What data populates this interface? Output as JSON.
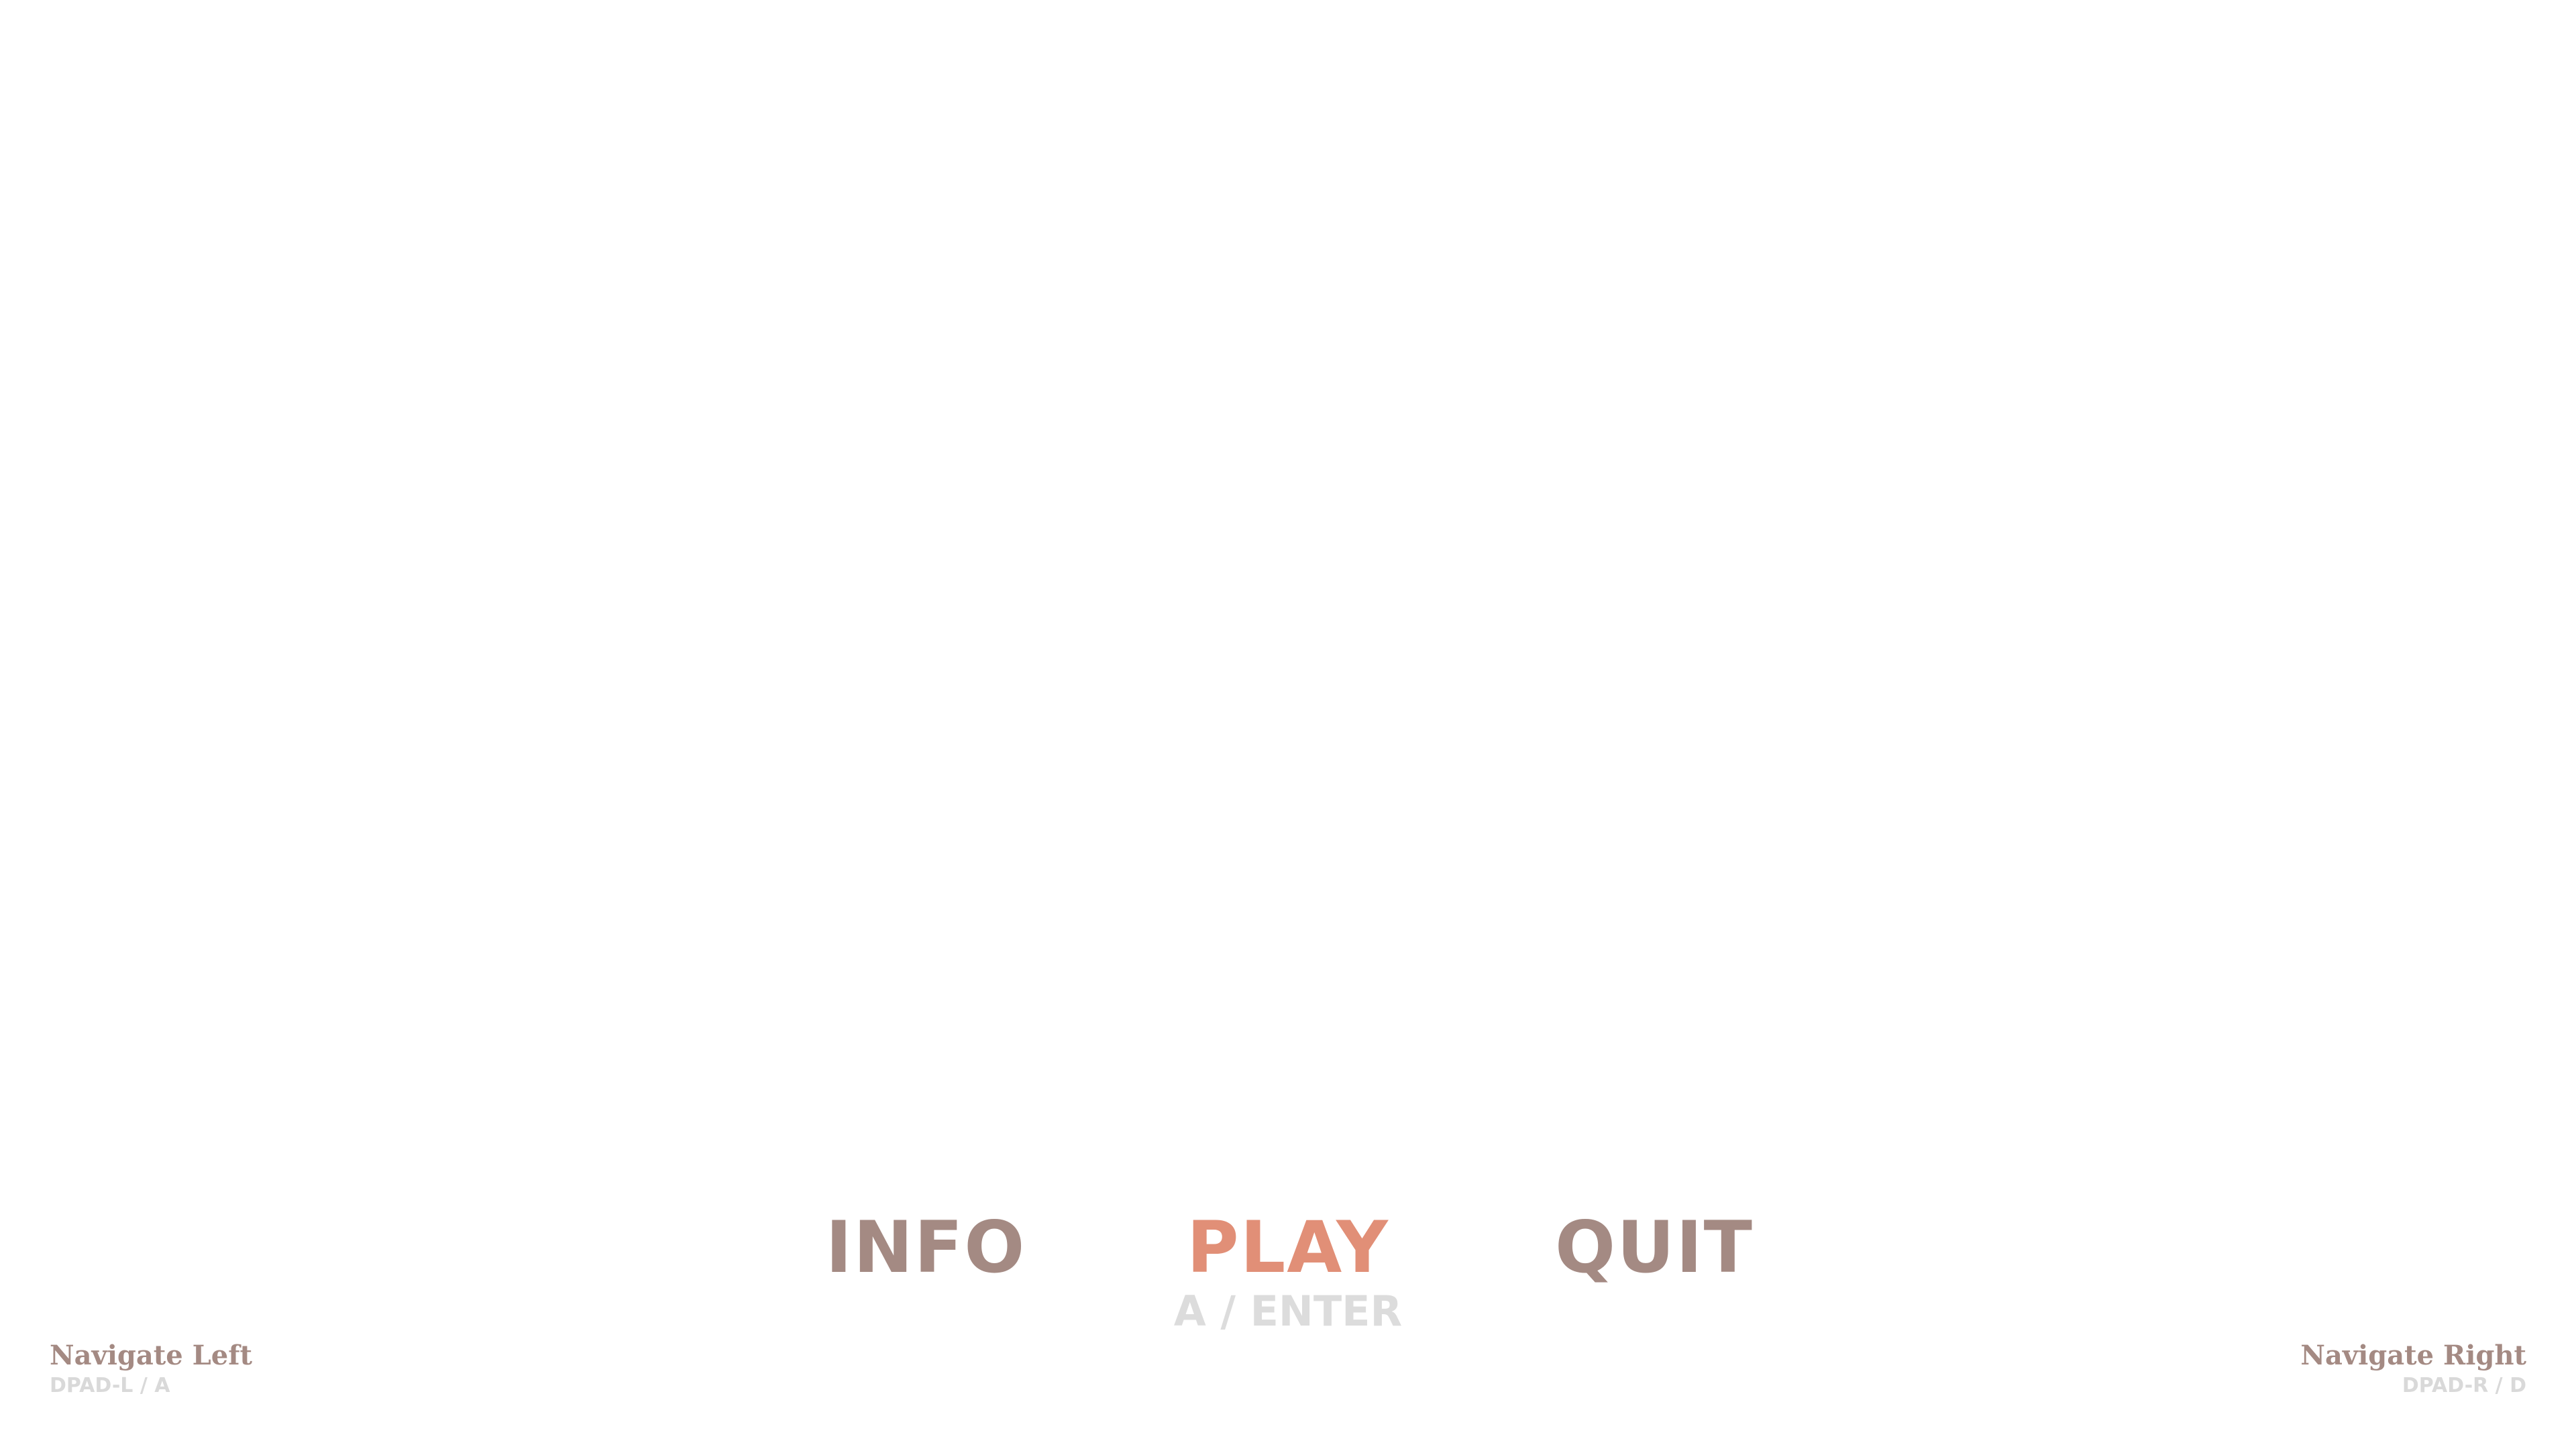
{
  "menu": {
    "items": [
      {
        "label": "INFO",
        "selected": false
      },
      {
        "label": "PLAY",
        "selected": true,
        "hint": "A / ENTER"
      },
      {
        "label": "QUIT",
        "selected": false
      }
    ]
  },
  "nav": {
    "left": {
      "label": "Navigate Left",
      "keys": "DPAD-L / A"
    },
    "right": {
      "label": "Navigate Right",
      "keys": "DPAD-R / D"
    }
  },
  "colors": {
    "background": "#ffffff",
    "menu_item": "#a48a83",
    "menu_item_selected": "#e18f77",
    "hint_text": "#dcdcdc"
  }
}
